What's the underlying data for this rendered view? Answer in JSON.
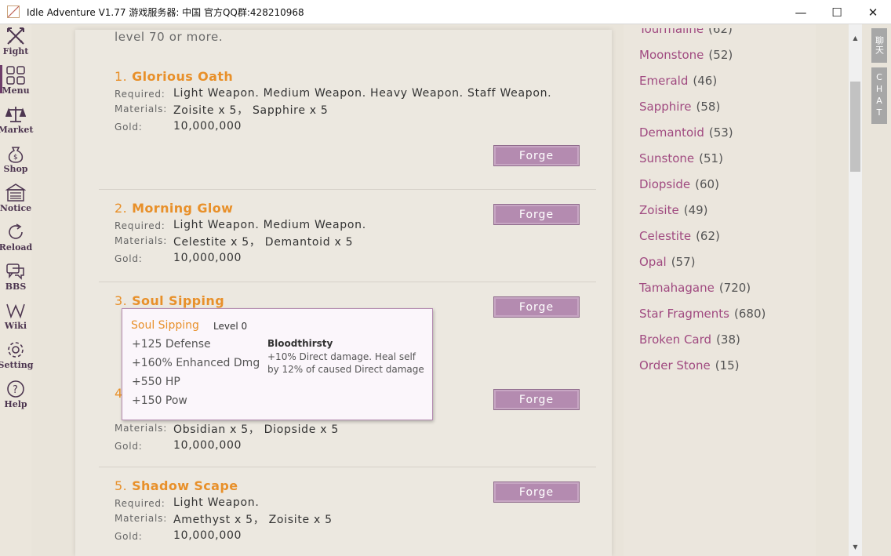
{
  "window": {
    "title": "Idle Adventure V1.77 游戏服务器: 中国 官方QQ群:428210968",
    "minimize": "—",
    "maximize": "☐",
    "close": "✕"
  },
  "nav": [
    {
      "label": "Fight",
      "icon": "crossed-swords-icon"
    },
    {
      "label": "Menu",
      "icon": "grid-menu-icon"
    },
    {
      "label": "Market",
      "icon": "scales-icon"
    },
    {
      "label": "Shop",
      "icon": "money-bag-icon"
    },
    {
      "label": "Notice",
      "icon": "notice-board-icon"
    },
    {
      "label": "Reload",
      "icon": "reload-icon"
    },
    {
      "label": "BBS",
      "icon": "chat-bubbles-icon"
    },
    {
      "label": "Wiki",
      "icon": "wiki-icon"
    },
    {
      "label": "Setting",
      "icon": "gear-icon"
    },
    {
      "label": "Help",
      "icon": "help-icon"
    }
  ],
  "intro_text": "level 70 or more.",
  "labels": {
    "required": "Required:",
    "materials": "Materials:",
    "gold": "Gold:",
    "forge": "Forge"
  },
  "recipes": [
    {
      "num": "1.",
      "name": "Glorious Oath",
      "required": "Light Weapon.  Medium Weapon.  Heavy Weapon.  Staff Weapon.",
      "materials": "Zoisite x 5， Sapphire x 5",
      "gold": "10,000,000"
    },
    {
      "num": "2.",
      "name": "Morning Glow",
      "required": "Light Weapon.  Medium Weapon.",
      "materials": "Celestite x 5， Demantoid x 5",
      "gold": "10,000,000"
    },
    {
      "num": "3.",
      "name": "Soul Sipping",
      "required": "",
      "materials": "",
      "gold": ""
    },
    {
      "num": "4",
      "name": "",
      "required": "",
      "materials": "Obsidian x 5， Diopside x 5",
      "gold": "10,000,000"
    },
    {
      "num": "5.",
      "name": "Shadow Scape",
      "required": "Light Weapon.",
      "materials": "Amethyst x 5， Zoisite x 5",
      "gold": "10,000,000"
    }
  ],
  "tooltip": {
    "name": "Soul Sipping",
    "level": "Level 0",
    "stats": [
      "+125 Defense",
      "+160% Enhanced Dmg",
      "+550 HP",
      "+150 Pow"
    ],
    "skill_name": "Bloodthirsty",
    "skill_desc": "+10% Direct damage. Heal self by 12% of caused Direct damage"
  },
  "gems": [
    {
      "name": "Tourmaline",
      "count": "(62)"
    },
    {
      "name": "Moonstone",
      "count": "(52)"
    },
    {
      "name": "Emerald",
      "count": "(46)"
    },
    {
      "name": "Sapphire",
      "count": "(58)"
    },
    {
      "name": "Demantoid",
      "count": "(53)"
    },
    {
      "name": "Sunstone",
      "count": "(51)"
    },
    {
      "name": "Diopside",
      "count": "(60)"
    },
    {
      "name": "Zoisite",
      "count": "(49)"
    },
    {
      "name": "Celestite",
      "count": "(62)"
    },
    {
      "name": "Opal",
      "count": "(57)"
    },
    {
      "name": "Tamahagane",
      "count": "(720)"
    },
    {
      "name": "Star Fragments",
      "count": "(680)"
    },
    {
      "name": "Broken Card",
      "count": "(38)"
    },
    {
      "name": "Order Stone",
      "count": "(15)"
    }
  ],
  "chat_tabs": {
    "cn": "聊天",
    "en": "CHAT"
  },
  "scroll": {
    "up": "▲",
    "down": "▼"
  }
}
